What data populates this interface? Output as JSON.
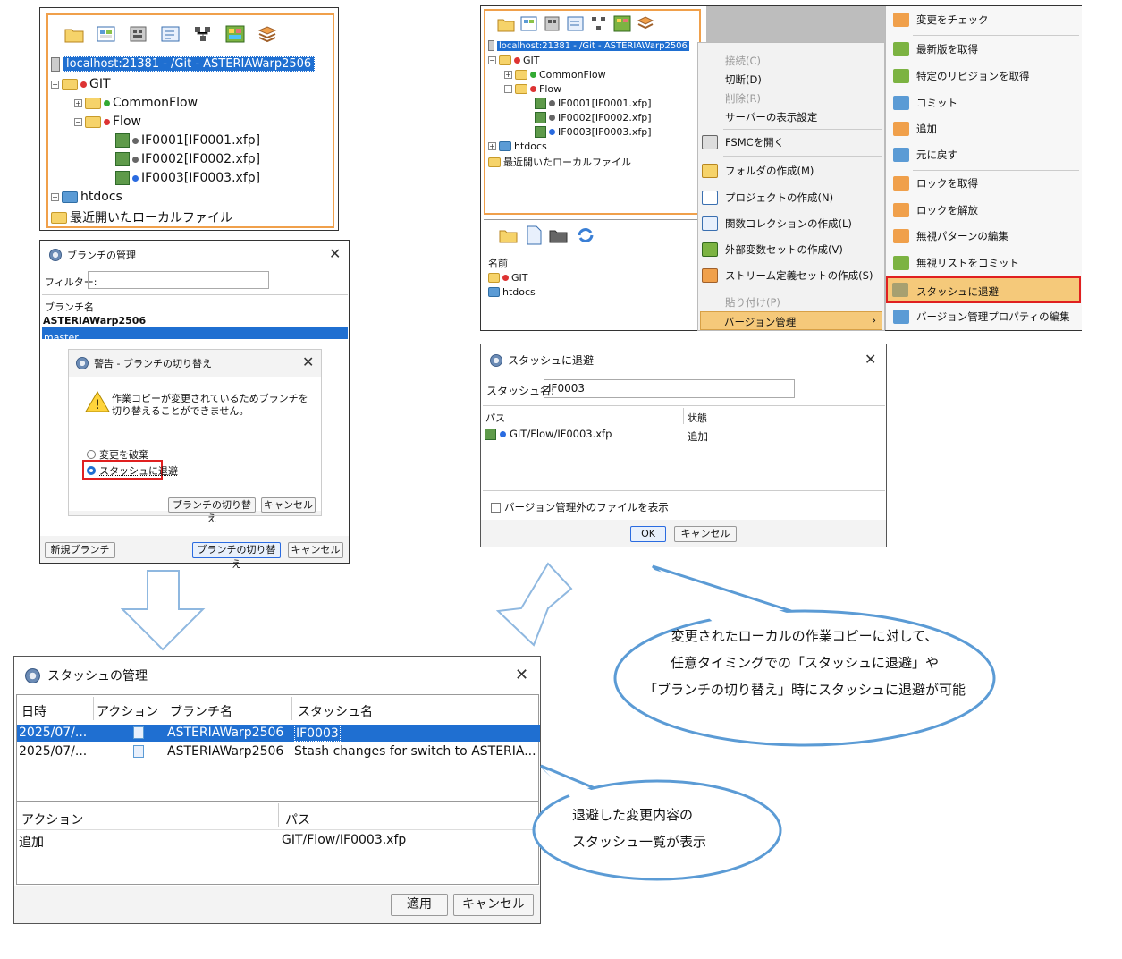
{
  "tree_panel_left": {
    "root_label": "localhost:21381 - /Git - ASTERIAWarp2506",
    "items": [
      "GIT",
      "CommonFlow",
      "Flow",
      "IF0001[IF0001.xfp]",
      "IF0002[IF0002.xfp]",
      "IF0003[IF0003.xfp]",
      "htdocs",
      "最近開いたローカルファイル"
    ]
  },
  "branch_dialog": {
    "title": "ブランチの管理",
    "filter_label": "フィルター:",
    "column_header": "ブランチ名",
    "rows": [
      "ASTERIAWarp2506",
      "master"
    ],
    "new_branch_button": "新規ブランチ",
    "switch_button": "ブランチの切り替え",
    "cancel_button": "キャンセル"
  },
  "warning_dialog": {
    "title": "警告 - ブランチの切り替え",
    "message_line1": "作業コピーが変更されているためブランチを",
    "message_line2": "切り替えることができません。",
    "option_discard": "変更を破棄",
    "option_stash": "スタッシュに退避",
    "switch_button": "ブランチの切り替え",
    "cancel_button": "キャンセル"
  },
  "tree_panel_right": {
    "root_label": "localhost:21381 - /Git - ASTERIAWarp2506",
    "items": [
      "GIT",
      "CommonFlow",
      "Flow",
      "IF0001[IF0001.xfp]",
      "IF0002[IF0002.xfp]",
      "IF0003[IF0003.xfp]",
      "htdocs",
      "最近開いたローカルファイル"
    ],
    "bottom_header": "名前",
    "bottom_items": [
      "GIT",
      "htdocs"
    ]
  },
  "context_menu": {
    "items": [
      "接続(C)",
      "切断(D)",
      "削除(R)",
      "サーバーの表示設定",
      "FSMCを開く",
      "フォルダの作成(M)",
      "プロジェクトの作成(N)",
      "関数コレクションの作成(L)",
      "外部変数セットの作成(V)",
      "ストリーム定義セットの作成(S)",
      "貼り付け(P)",
      "バージョン管理"
    ]
  },
  "submenu": {
    "items": [
      "変更をチェック",
      "最新版を取得",
      "特定のリビジョンを取得",
      "コミット",
      "追加",
      "元に戻す",
      "ロックを取得",
      "ロックを解放",
      "無視パターンの編集",
      "無視リストをコミット",
      "スタッシュに退避",
      "バージョン管理プロパティの編集"
    ]
  },
  "stash_dialog": {
    "title": "スタッシュに退避",
    "name_label": "スタッシュ名:",
    "name_value": "IF0003",
    "col_path": "パス",
    "col_state": "状態",
    "row_path": "GIT/Flow/IF0003.xfp",
    "row_state": "追加",
    "checkbox_label": "バージョン管理外のファイルを表示",
    "ok_button": "OK",
    "cancel_button": "キャンセル"
  },
  "stash_manager": {
    "title": "スタッシュの管理",
    "col_date": "日時",
    "col_action": "アクション",
    "col_branch": "ブランチ名",
    "col_stash": "スタッシュ名",
    "rows": [
      {
        "date": "2025/07/...",
        "branch": "ASTERIAWarp2506",
        "stash": "IF0003"
      },
      {
        "date": "2025/07/...",
        "branch": "ASTERIAWarp2506",
        "stash": "Stash changes for switch to ASTERIA..."
      }
    ],
    "col_action2": "アクション",
    "col_path": "パス",
    "detail_action": "追加",
    "detail_path": "GIT/Flow/IF0003.xfp",
    "apply_button": "適用",
    "cancel_button": "キャンセル"
  },
  "callout_1": {
    "line1": "変更されたローカルの作業コピーに対して、",
    "line2": "任意タイミングでの「スタッシュに退避」や",
    "line3": "「ブランチの切り替え」時にスタッシュに退避が可能"
  },
  "callout_2": {
    "line1": "退避した変更内容の",
    "line2": "スタッシュ一覧が表示"
  },
  "colors": {
    "accent_orange": "#f0a04b",
    "selection_blue": "#1f6fd1",
    "highlight_red": "#e02020",
    "bubble_stroke": "#5b9bd5",
    "arrow_stroke": "#8fb8e0"
  }
}
